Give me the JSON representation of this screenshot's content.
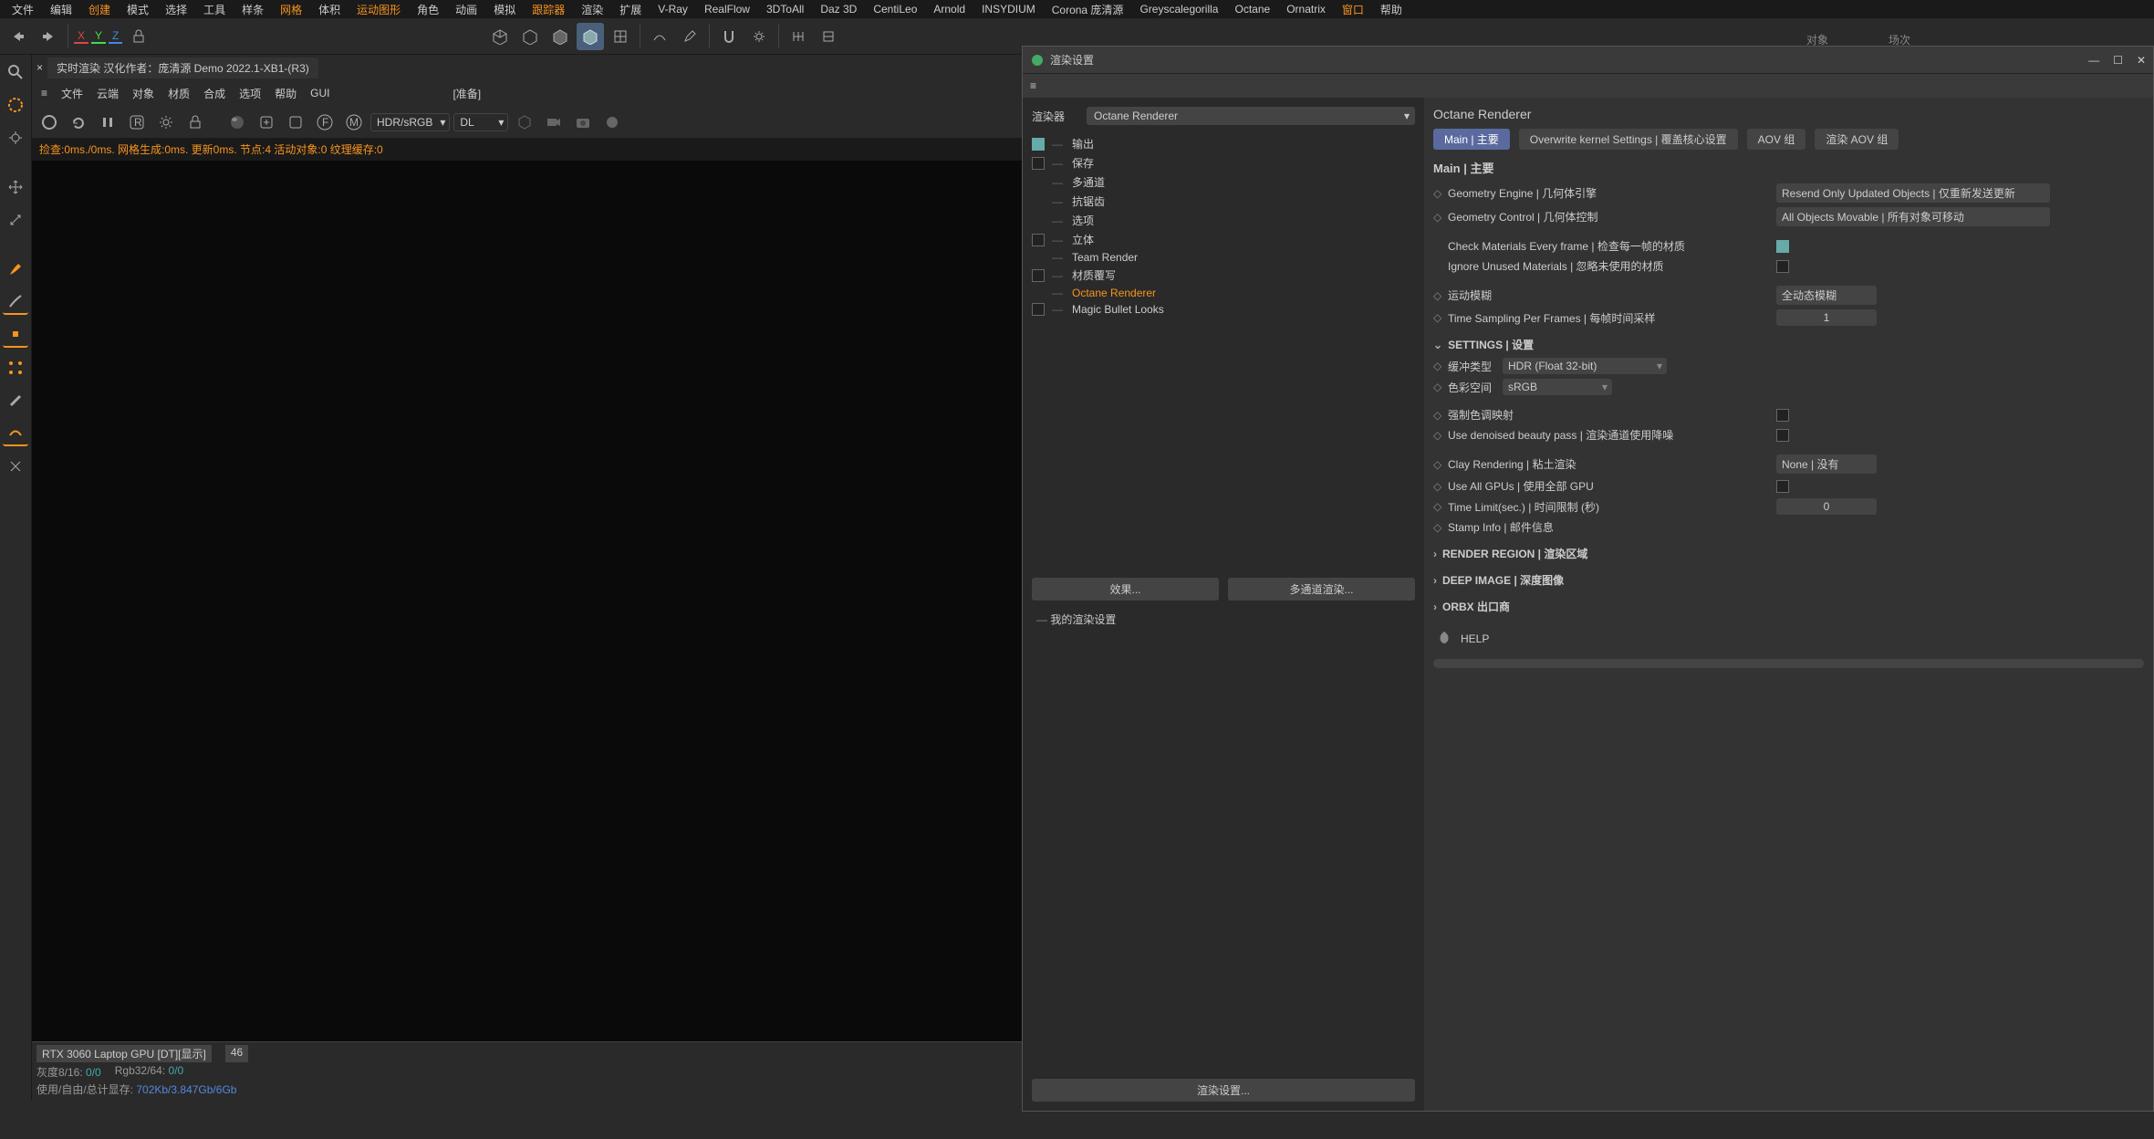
{
  "top_menu": [
    "文件",
    "编辑",
    "创建",
    "模式",
    "选择",
    "工具",
    "样条",
    "网格",
    "体积",
    "运动图形",
    "角色",
    "动画",
    "模拟",
    "跟踪器",
    "渲染",
    "扩展",
    "V-Ray",
    "RealFlow",
    "3DToAll",
    "Daz 3D",
    "CentiLeo",
    "Arnold",
    "INSYDIUM",
    "Corona 庞清源",
    "Greyscalegorilla",
    "Octane",
    "Ornatrix",
    "窗口",
    "帮助"
  ],
  "top_menu_hl": [
    2,
    7,
    9,
    13,
    27
  ],
  "axis": {
    "x": "X",
    "y": "Y",
    "z": "Z"
  },
  "vp_tab": "实时渲染 汉化作者：庞清源 Demo 2022.1-XB1-(R3)",
  "vp_menu": [
    "文件",
    "云端",
    "对象",
    "材质",
    "合成",
    "选项",
    "帮助",
    "GUI"
  ],
  "vp_prep": "[准备]",
  "vp_sel1": "HDR/sRGB",
  "vp_sel2": "DL",
  "vp_status": "捡查:0ms./0ms. 网格生成:0ms. 更新0ms. 节点:4 活动对象:0 纹理缓存:0",
  "status": {
    "gpu": "RTX 3060 Laptop GPU [DT][显示]",
    "gpu_num": "46",
    "gray": "灰度8/16:",
    "gray_v": "0/0",
    "rgb": "Rgb32/64:",
    "rgb_v": "0/0",
    "mem": "使用/自由/总计显存:",
    "mem_v": "702Kb/3.847Gb/6Gb"
  },
  "obj_lbl": "对象",
  "scene_lbl": "场次",
  "dialog": {
    "title": "渲染设置",
    "renderer_lbl": "渲染器",
    "renderer_val": "Octane Renderer",
    "tree": [
      {
        "cb": "checked",
        "txt": "输出"
      },
      {
        "cb": "off",
        "txt": "保存"
      },
      {
        "cb": "spacer",
        "txt": "多通道"
      },
      {
        "cb": "spacer",
        "txt": "抗锯齿"
      },
      {
        "cb": "spacer",
        "txt": "选项"
      },
      {
        "cb": "off",
        "txt": "立体"
      },
      {
        "cb": "spacer",
        "txt": "Team Render"
      },
      {
        "cb": "off",
        "txt": "材质覆写"
      },
      {
        "cb": "spacer",
        "txt": "Octane Renderer",
        "active": true
      },
      {
        "cb": "off",
        "txt": "Magic Bullet Looks"
      }
    ],
    "btn_fx": "效果...",
    "btn_multi": "多通道渲染...",
    "preset": "我的渲染设置",
    "footer_btn": "渲染设置...",
    "right_title": "Octane Renderer",
    "tabs": [
      "Main | 主要",
      "Overwrite kernel Settings | 覆盖核心设置",
      "AOV 组",
      "渲染 AOV 组"
    ],
    "sub": "Main | 主要",
    "r_geo_engine": {
      "lbl": "Geometry Engine | 几何体引擎",
      "val": "Resend Only Updated Objects | 仅重新发送更新"
    },
    "r_geo_ctrl": {
      "lbl": "Geometry Control | 几何体控制",
      "val": "All Objects Movable | 所有对象可移动"
    },
    "r_check_mat": {
      "lbl": "Check Materials Every frame | 检查每一帧的材质"
    },
    "r_ignore_mat": {
      "lbl": "Ignore Unused Materials | 忽略未使用的材质"
    },
    "r_motion": {
      "lbl": "运动模糊",
      "val": "全动态模糊"
    },
    "r_time_samp": {
      "lbl": "Time Sampling Per Frames | 每帧时间采样",
      "val": "1"
    },
    "sect_settings": "SETTINGS | 设置",
    "r_buffer": {
      "lbl": "缓冲类型",
      "val": "HDR (Float 32-bit)"
    },
    "r_colorspace": {
      "lbl": "色彩空间",
      "val": "sRGB"
    },
    "r_tonemap": {
      "lbl": "强制色调映射"
    },
    "r_denoise": {
      "lbl": "Use denoised beauty pass | 渲染通道使用降噪"
    },
    "r_clay": {
      "lbl": "Clay Rendering | 粘土渲染",
      "val": "None | 没有"
    },
    "r_allgpu": {
      "lbl": "Use All GPUs | 使用全部 GPU"
    },
    "r_timelimit": {
      "lbl": "Time Limit(sec.) | 时间限制 (秒)",
      "val": "0"
    },
    "r_stamp": {
      "lbl": "Stamp Info | 邮件信息"
    },
    "sect_region": "RENDER REGION | 渲染区域",
    "sect_deep": "DEEP IMAGE | 深度图像",
    "sect_orbx": "ORBX 出口商",
    "help": "HELP"
  }
}
